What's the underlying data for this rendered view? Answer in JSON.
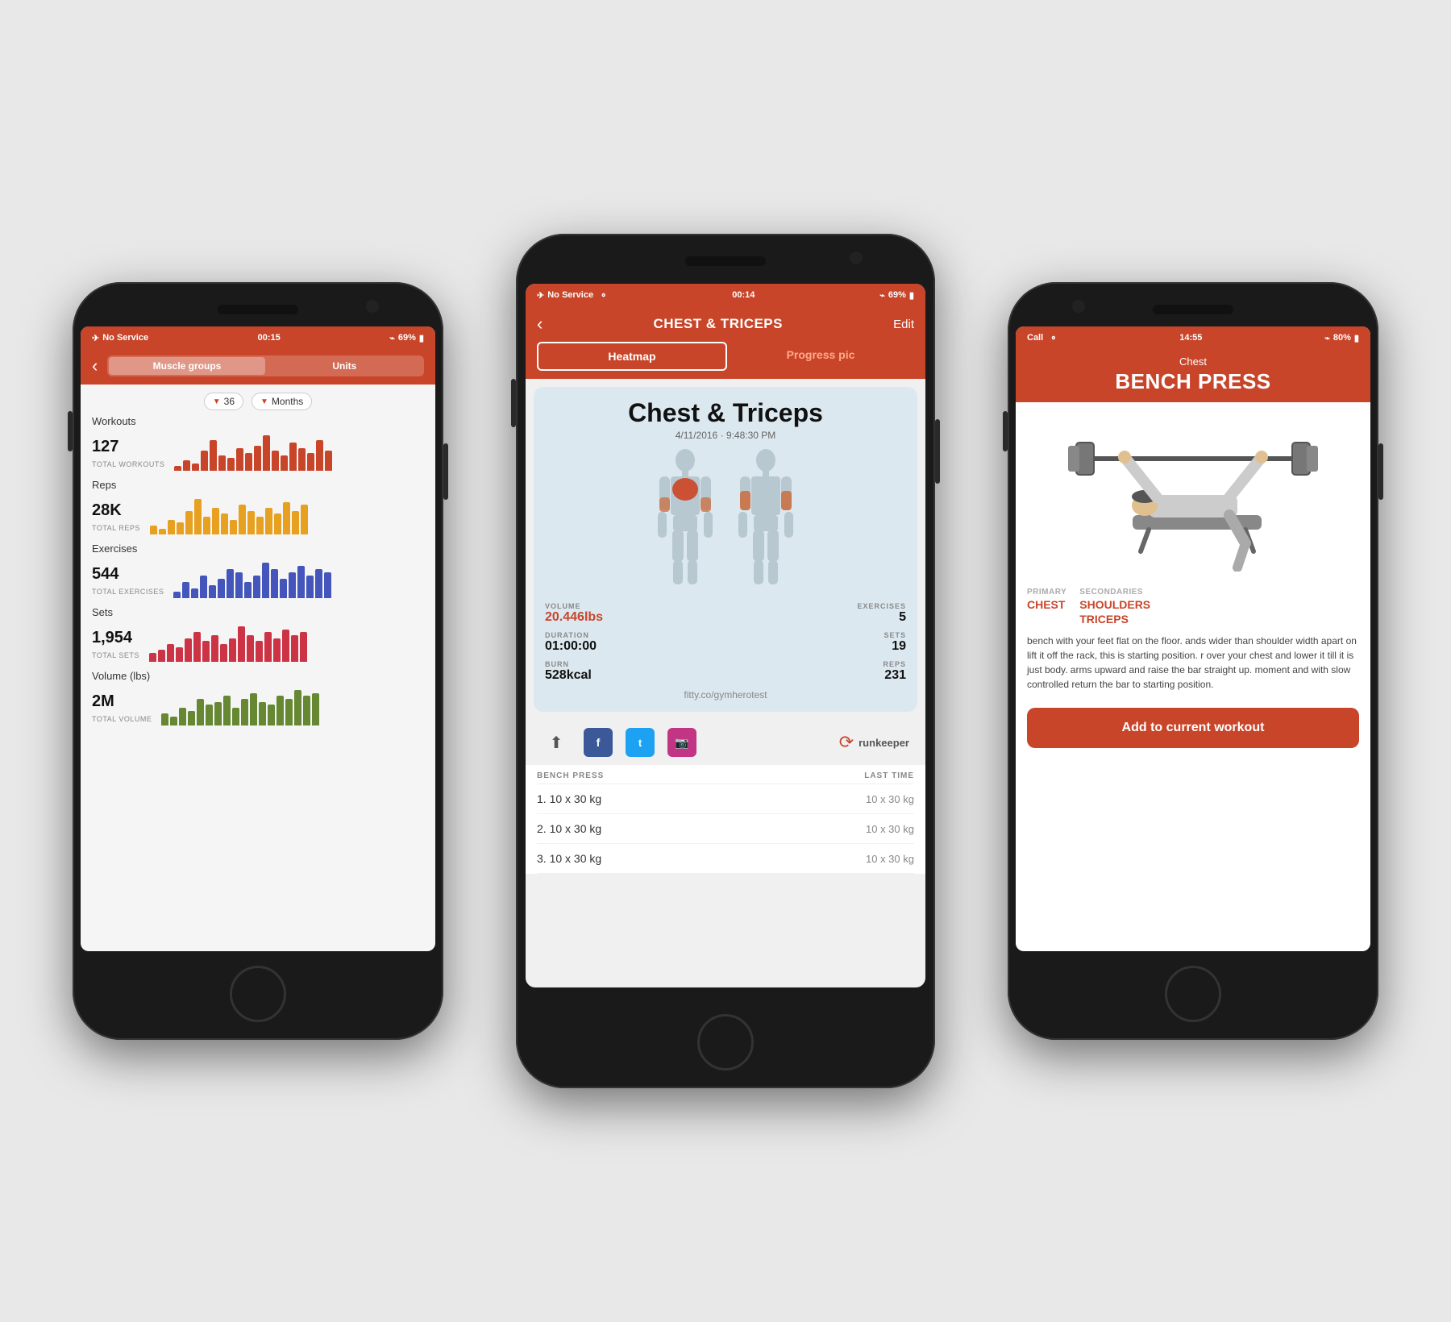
{
  "colors": {
    "orange": "#c8452a",
    "dark": "#1a1a1a",
    "light_bg": "#f5f5f5",
    "card_bg": "#dce8f0"
  },
  "left_phone": {
    "status": {
      "service": "No Service",
      "time": "00:15",
      "bluetooth": "BT",
      "battery": "69%"
    },
    "nav": {
      "back": "‹",
      "tabs": [
        "Muscle groups",
        "Units"
      ]
    },
    "filter": {
      "value": "36",
      "period": "Months"
    },
    "stats": [
      {
        "label": "Workouts",
        "value": "127",
        "sub": "TOTAL WORKOUTS",
        "color": "#c8452a",
        "bars": [
          2,
          4,
          3,
          8,
          12,
          6,
          5,
          9,
          7,
          10,
          14,
          8,
          6,
          11,
          9,
          7,
          12,
          8
        ]
      },
      {
        "label": "Reps",
        "value": "28K",
        "sub": "TOTAL REPS",
        "color": "#e8a020",
        "bars": [
          3,
          2,
          5,
          4,
          8,
          12,
          6,
          9,
          7,
          5,
          10,
          8,
          6,
          9,
          7,
          11,
          8,
          10
        ]
      },
      {
        "label": "Exercises",
        "value": "544",
        "sub": "TOTAL EXERCISES",
        "color": "#4455bb",
        "bars": [
          2,
          5,
          3,
          7,
          4,
          6,
          9,
          8,
          5,
          7,
          11,
          9,
          6,
          8,
          10,
          7,
          9,
          8
        ]
      },
      {
        "label": "Sets",
        "value": "1,954",
        "sub": "TOTAL SETS",
        "color": "#cc3344",
        "bars": [
          3,
          4,
          6,
          5,
          8,
          10,
          7,
          9,
          6,
          8,
          12,
          9,
          7,
          10,
          8,
          11,
          9,
          10
        ]
      },
      {
        "label": "Volume (lbs)",
        "value": "2M",
        "sub": "TOTAL VOLUME",
        "color": "#668833",
        "bars": [
          4,
          3,
          6,
          5,
          9,
          7,
          8,
          10,
          6,
          9,
          11,
          8,
          7,
          10,
          9,
          12,
          10,
          11
        ]
      }
    ]
  },
  "center_phone": {
    "status": {
      "service": "No Service",
      "wifi": "wifi",
      "time": "00:14",
      "bluetooth": "BT",
      "battery": "69%"
    },
    "header": {
      "back": "‹",
      "title": "CHEST & TRICEPS",
      "edit": "Edit"
    },
    "tabs": [
      "Heatmap",
      "Progress pic"
    ],
    "active_tab": "Heatmap",
    "workout": {
      "title": "Chest & Triceps",
      "date": "4/11/2016 · 9:48:30 PM",
      "volume_label": "VOLUME",
      "volume_value": "20.446lbs",
      "exercises_label": "EXERCISES",
      "exercises_value": "5",
      "duration_label": "DURATION",
      "duration_value": "01:00:00",
      "sets_label": "SETS",
      "sets_value": "19",
      "burn_label": "BURN",
      "burn_value": "528kcal",
      "reps_label": "REPS",
      "reps_value": "231",
      "url": "fitty.co/gymherotest"
    },
    "exercises": {
      "header_name": "BENCH PRESS",
      "header_last": "LAST TIME",
      "rows": [
        {
          "num": "1.",
          "set": "10 x 30 kg",
          "last": "10 x 30 kg"
        },
        {
          "num": "2.",
          "set": "10 x 30 kg",
          "last": "10 x 30 kg"
        },
        {
          "num": "3.",
          "set": "10 x 30 kg",
          "last": "10 x 30 kg"
        }
      ]
    }
  },
  "right_phone": {
    "status": {
      "service": "Call",
      "wifi": "wifi",
      "time": "14:55",
      "bluetooth": "BT",
      "battery": "80%"
    },
    "header": {
      "category": "Chest",
      "title": "BENCH PRESS"
    },
    "muscles": {
      "primary_label": "PRIMARY",
      "primary_value": "CHEST",
      "secondary_label": "SECONDARIES",
      "secondary_values": [
        "SHOULDERS",
        "TRICEPS"
      ]
    },
    "description": "bench with your feet flat on the floor. ands wider than shoulder width apart on lift it off the rack, this is starting position. r over your chest and lower it till it is just body.\n\narms upward and raise the bar straight up. moment and with slow controlled return the bar to starting position.",
    "add_button": "Add to current workout"
  }
}
